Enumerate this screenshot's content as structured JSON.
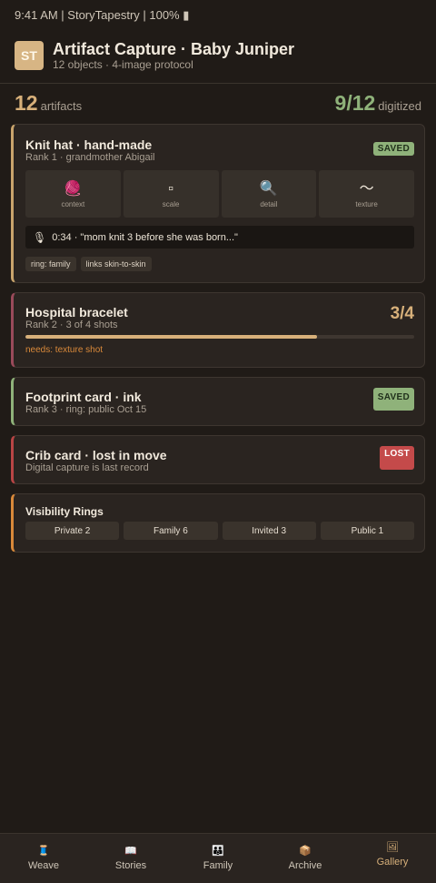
{
  "status_bar": "9:41 AM | StoryTapestry | 100% ▮",
  "header": {
    "avatar": "ST",
    "title": "Artifact Capture · Baby Juniper",
    "subtitle": "12 objects · 4-image protocol"
  },
  "summary": {
    "artifacts_count": "12",
    "artifacts_label": "artifacts",
    "digitized_count": "9/12",
    "digitized_label": "digitized"
  },
  "cards": {
    "knit_hat": {
      "title": "Knit hat · hand-made",
      "subtitle": "Rank 1 · grandmother Abigail",
      "badge": "SAVED",
      "accent": "#c9a46c",
      "shots": [
        {
          "icon": "🧶",
          "icon_name": "yarn-ball-icon",
          "label": "context"
        },
        {
          "icon": "▫",
          "icon_name": "square-icon",
          "label": "scale"
        },
        {
          "icon": "🔍",
          "icon_name": "magnifier-icon",
          "label": "detail"
        },
        {
          "icon": "〜",
          "icon_name": "wave-icon",
          "label": "texture"
        }
      ],
      "audio": "0:34 · \"mom knit 3 before she was born...\"",
      "tags": [
        "ring: family",
        "links skin-to-skin"
      ]
    },
    "hospital_bracelet": {
      "title": "Hospital bracelet",
      "subtitle": "Rank 2 · 3 of 4 shots",
      "progress_label": "3/4",
      "progress": 0.75,
      "needs": "needs: texture shot",
      "accent": "#9a4a5a"
    },
    "footprint_card": {
      "title": "Footprint card · ink",
      "subtitle": "Rank 3 · ring: public Oct 15",
      "badge": "SAVED",
      "accent": "#8fb27a"
    },
    "crib_card": {
      "title": "Crib card · lost in move",
      "subtitle": "Digital capture is last record",
      "badge": "LOST",
      "accent": "#b94545"
    },
    "visibility_rings": {
      "title": "Visibility Rings",
      "rings": [
        "Private 2",
        "Family 6",
        "Invited 3",
        "Public 1"
      ],
      "accent": "#d9893a"
    }
  },
  "bottom_nav": [
    {
      "icon": "🧵",
      "icon_name": "thread-icon",
      "label": "Weave"
    },
    {
      "icon": "📖",
      "icon_name": "book-icon",
      "label": "Stories"
    },
    {
      "icon": "👪",
      "icon_name": "family-icon",
      "label": "Family"
    },
    {
      "icon": "📦",
      "icon_name": "box-icon",
      "label": "Archive"
    },
    {
      "icon": "🖼",
      "icon_name": "picture-icon",
      "label": "Gallery",
      "active": true
    }
  ],
  "colors": {
    "background": "#201b17",
    "card": "#2a2420",
    "gold": "#d7b07a",
    "green": "#8fb27a",
    "red": "#c44a4a",
    "orange": "#d9893a"
  }
}
